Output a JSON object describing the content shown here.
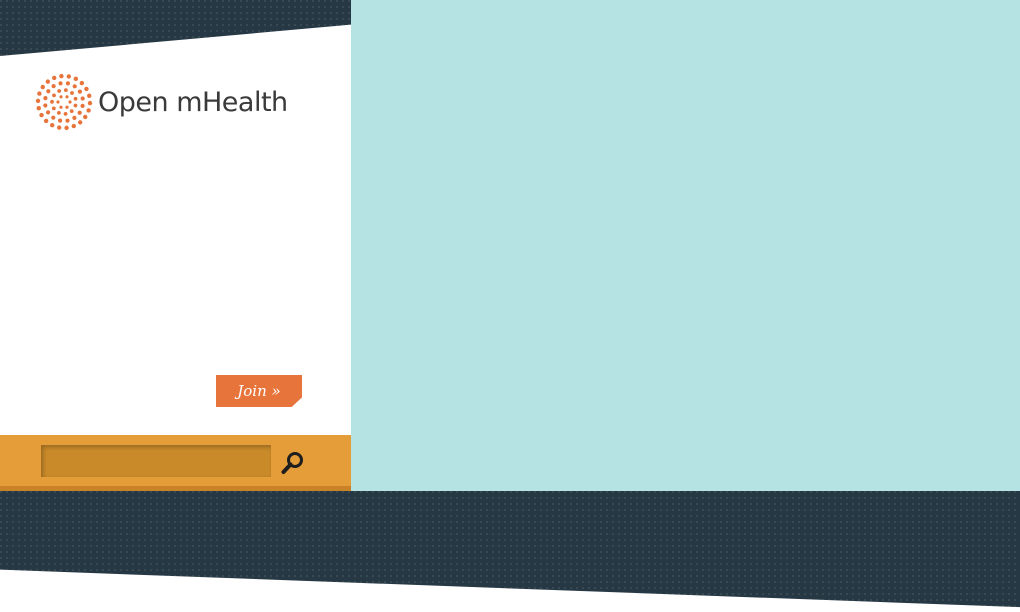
{
  "brand": {
    "name": "Open mHealth",
    "logo_icon": "sunburst-dots-icon",
    "accent_color": "#e7743b"
  },
  "nav": {
    "join_label": "Join »"
  },
  "search": {
    "placeholder": "",
    "value": "",
    "icon": "magnifier-icon",
    "bar_color": "#e59d3a"
  },
  "colors": {
    "hero_background": "#b5e3e3",
    "dark_band": "#263844",
    "panel_background": "#ffffff"
  }
}
